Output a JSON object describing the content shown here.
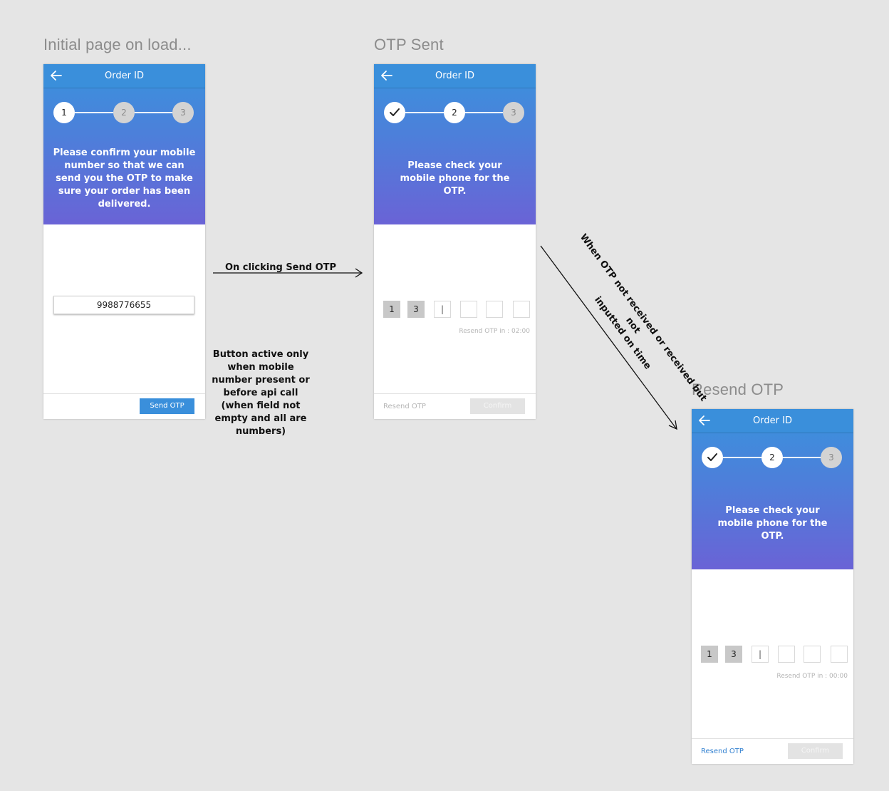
{
  "sections": {
    "initial": {
      "title": "Initial page on load..."
    },
    "otp_sent": {
      "title": "OTP Sent"
    },
    "resend": {
      "title": "Resend OTP"
    }
  },
  "screens": {
    "initial": {
      "title": "Order ID",
      "steps": [
        "1",
        "2",
        "3"
      ],
      "message": "Please confirm your mobile number so that we can send you the OTP to make sure your order has been delivered.",
      "mobile_value": "9988776655",
      "send_button": "Send OTP"
    },
    "otp_sent": {
      "title": "Order ID",
      "steps": [
        "✓",
        "2",
        "3"
      ],
      "message": "Please check your mobile phone for the OTP.",
      "otp_digits": [
        "1",
        "3",
        "|",
        "",
        "",
        ""
      ],
      "timer": "Resend OTP in : 02:00",
      "resend_label": "Resend OTP",
      "confirm_label": "Confirm"
    },
    "resend": {
      "title": "Order ID",
      "steps": [
        "✓",
        "2",
        "3"
      ],
      "message": "Please check your mobile phone for the OTP.",
      "otp_digits": [
        "1",
        "3",
        "|",
        "",
        "",
        ""
      ],
      "timer": "Resend OTP in : 00:00",
      "resend_label": "Resend OTP",
      "confirm_label": "Confirm"
    }
  },
  "annotations": {
    "on_click": "On clicking Send OTP",
    "button_note": "Button active only when mobile number present  or before api call (when field not empty and all are numbers)",
    "diagonal_line1": "When OTP not received or received but not",
    "diagonal_line2": "inputted on time"
  },
  "colors": {
    "primary": "#3a8fdb",
    "gradient_top": "#3993dd",
    "gradient_bottom": "#6a63d6",
    "link_active": "#2f7fd0",
    "link_disabled": "#b5b5b5",
    "background": "#e5e5e5"
  }
}
